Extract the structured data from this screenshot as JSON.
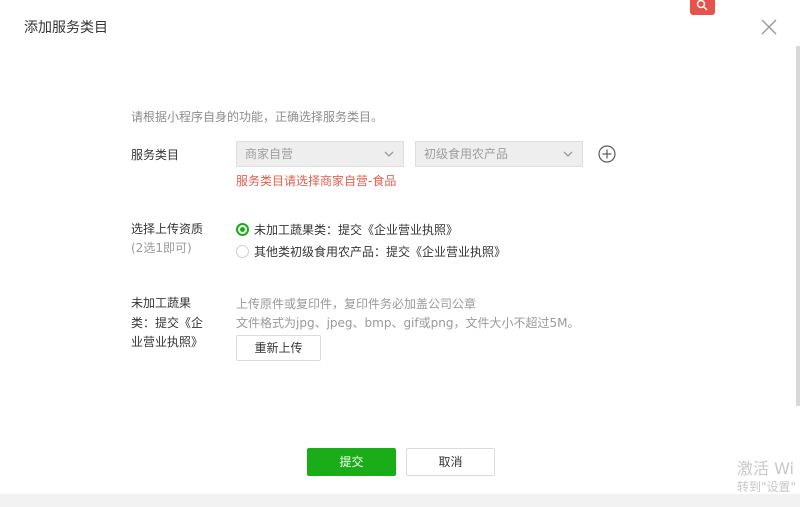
{
  "dialog": {
    "title": "添加服务类目",
    "hint": "请根据小程序自身的功能，正确选择服务类目。"
  },
  "category": {
    "label": "服务类目",
    "select1_value": "商家自营",
    "select2_value": "初级食用农产品",
    "error": "服务类目请选择商家自营-食品"
  },
  "qualification": {
    "label": "选择上传资质",
    "sublabel": "(2选1即可)",
    "options": [
      {
        "label": "未加工蔬果类：提交《企业营业执照》",
        "selected": true
      },
      {
        "label": "其他类初级食用农产品：提交《企业营业执照》",
        "selected": false
      }
    ]
  },
  "upload": {
    "label_line1": "未加工蔬果",
    "label_line2": "类：提交《企",
    "label_line3": "业营业执照》",
    "desc1": "上传原件或复印件，复印件务必加盖公司公章",
    "desc2": "文件格式为jpg、jpeg、bmp、gif或png，文件大小不超过5M。",
    "reupload_label": "重新上传"
  },
  "footer": {
    "submit_label": "提交",
    "cancel_label": "取消"
  },
  "watermark": {
    "line1": "激活 Wi",
    "line2": "转到\"设置\""
  },
  "colors": {
    "accent": "#1aad19",
    "error": "#e15f4f"
  }
}
